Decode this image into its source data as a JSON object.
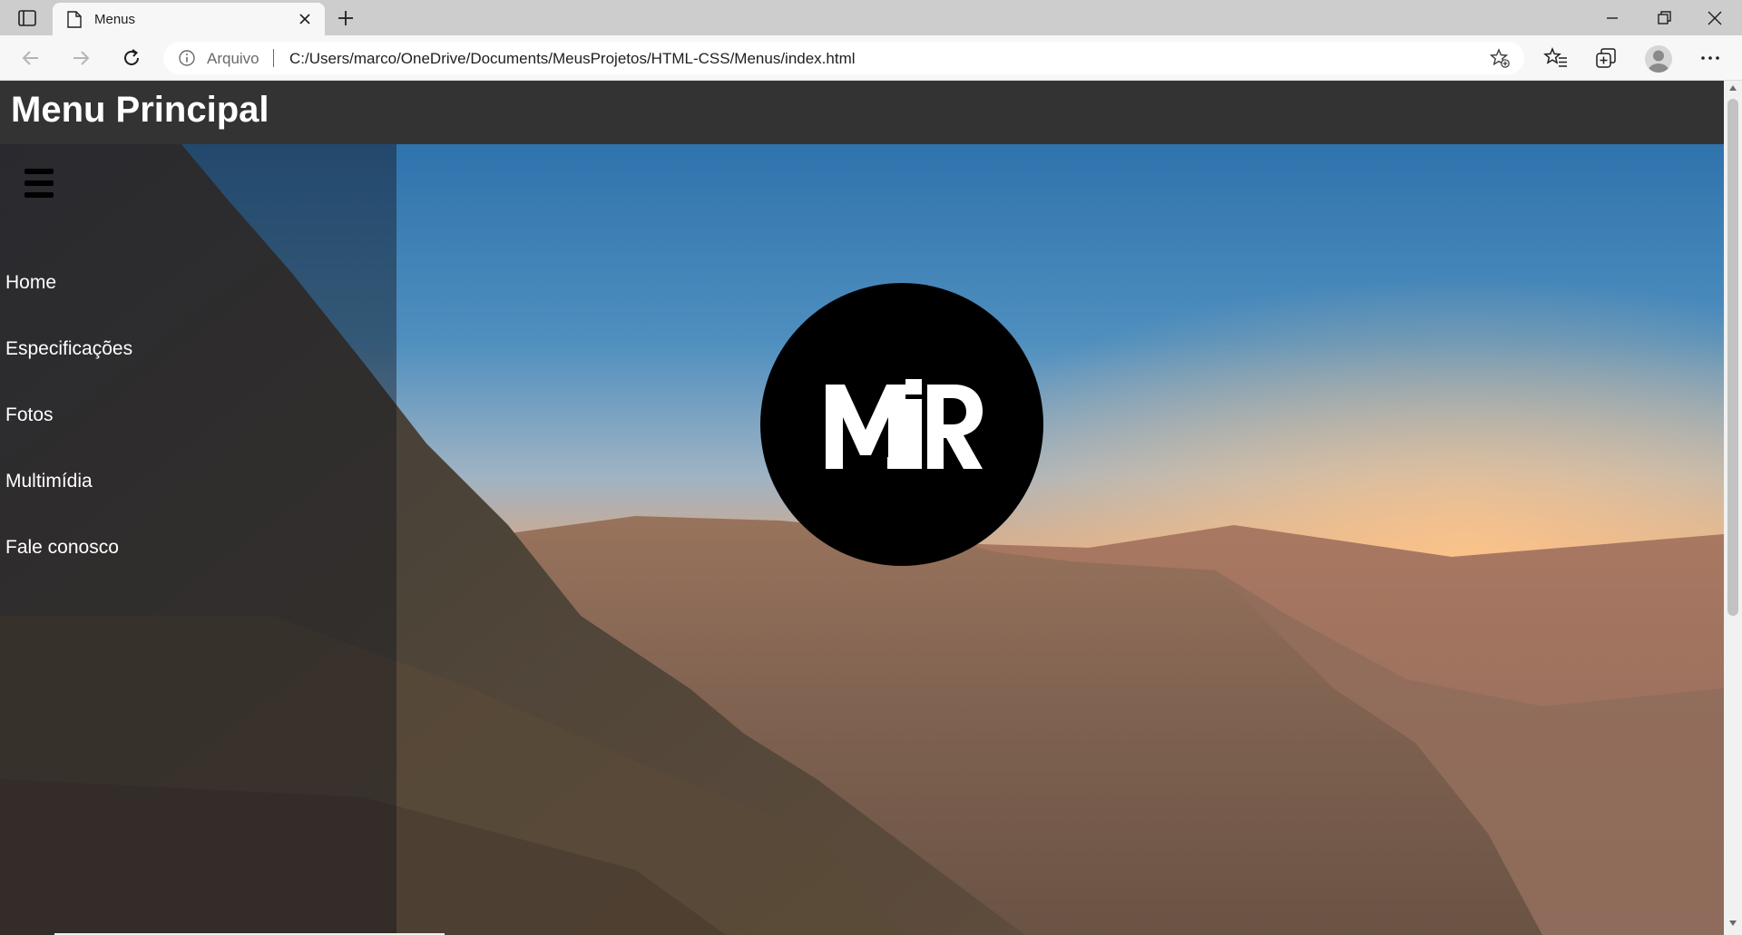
{
  "browser": {
    "tab_title": "Menus",
    "address": {
      "scheme_label": "Arquivo",
      "url": "C:/Users/marco/OneDrive/Documents/MeusProjetos/HTML-CSS/Menus/index.html"
    }
  },
  "page": {
    "header": {
      "title": "Menu Principal"
    },
    "menu": {
      "items": [
        {
          "label": "Home"
        },
        {
          "label": "Especificações"
        },
        {
          "label": "Fotos"
        },
        {
          "label": "Multimídia"
        },
        {
          "label": "Fale conosco"
        }
      ]
    },
    "logo": {
      "text": "MJR"
    }
  },
  "colors": {
    "header_bg": "#333333",
    "menu_text": "#ffffff",
    "logo_bg": "#000000"
  }
}
